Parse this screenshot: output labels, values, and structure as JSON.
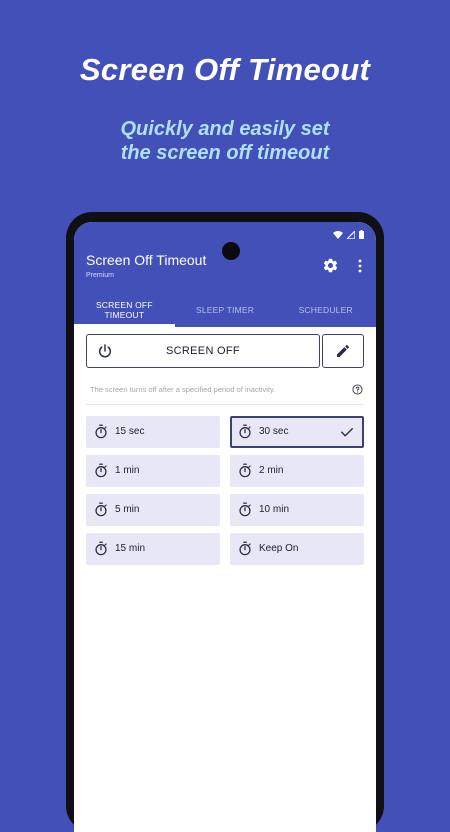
{
  "promo": {
    "title": "Screen Off Timeout",
    "subtitle_line1": "Quickly and easily set",
    "subtitle_line2": "the screen off timeout"
  },
  "app": {
    "title": "Screen Off Timeout",
    "subtitle": "Premium",
    "accent_color": "#4350b8"
  },
  "tabs": [
    {
      "label": "SCREEN OFF TIMEOUT",
      "active": true
    },
    {
      "label": "SLEEP TIMER",
      "active": false
    },
    {
      "label": "SCHEDULER",
      "active": false
    }
  ],
  "main": {
    "screen_off_label": "SCREEN OFF",
    "info_text": "The screen turns off after a specified period of inactivity."
  },
  "options": [
    {
      "label": "15 sec",
      "selected": false
    },
    {
      "label": "30 sec",
      "selected": true
    },
    {
      "label": "1 min",
      "selected": false
    },
    {
      "label": "2 min",
      "selected": false
    },
    {
      "label": "5 min",
      "selected": false
    },
    {
      "label": "10 min",
      "selected": false
    },
    {
      "label": "15 min",
      "selected": false
    },
    {
      "label": "Keep On",
      "selected": false
    }
  ],
  "icons": {
    "settings": "gear-icon",
    "overflow": "more-vert-icon",
    "power": "power-icon",
    "edit": "pencil-icon",
    "help": "help-circle-icon",
    "timer": "stopwatch-icon",
    "check": "check-icon"
  }
}
